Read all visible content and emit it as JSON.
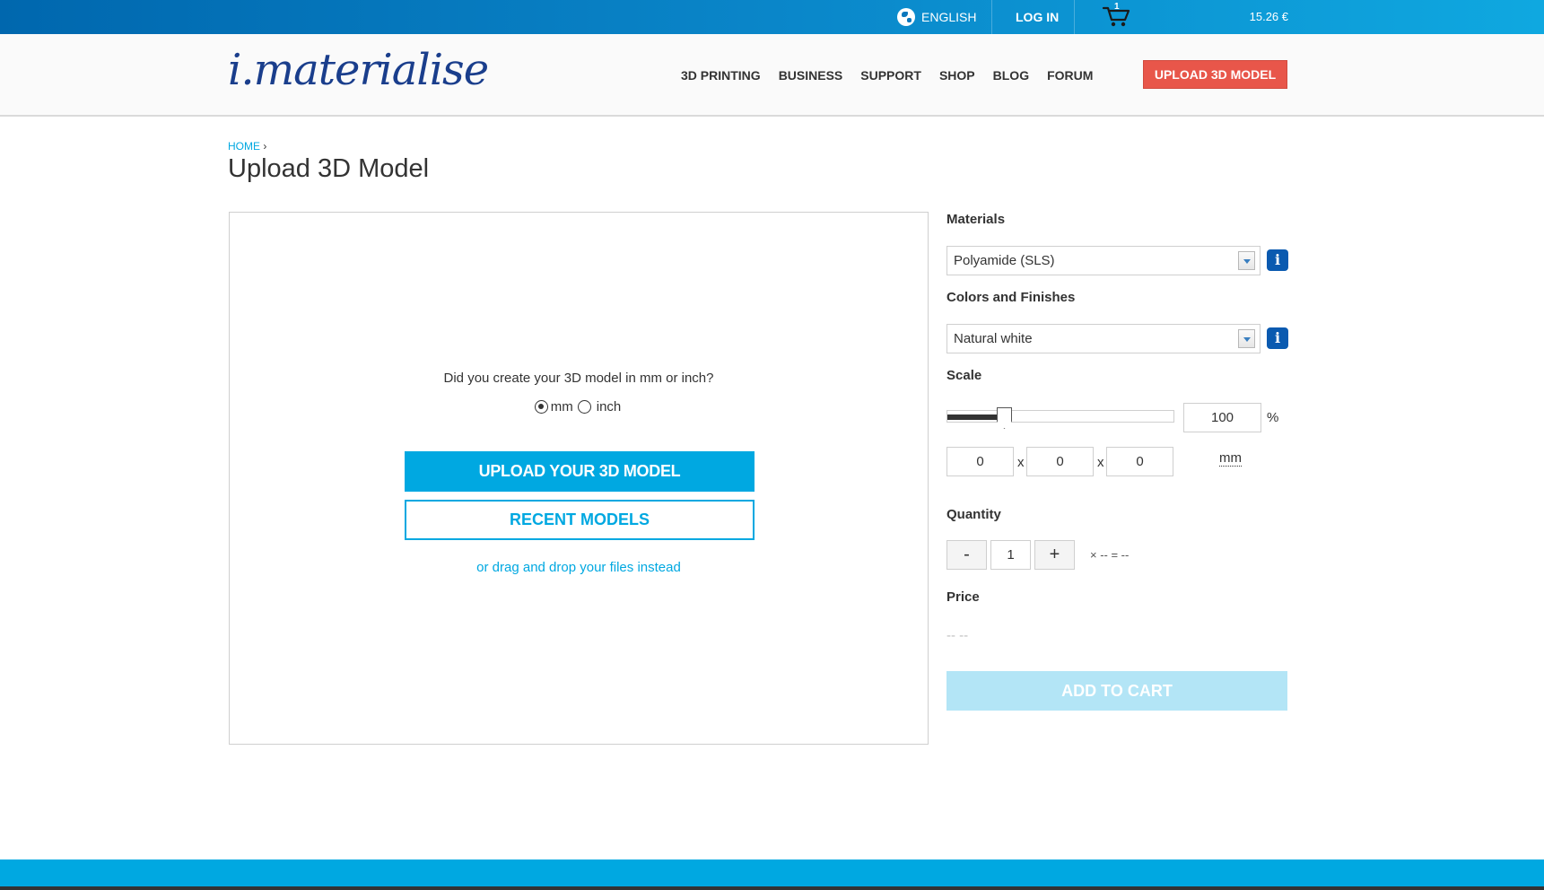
{
  "topbar": {
    "language": "ENGLISH",
    "login": "LOG IN",
    "cart_count": "1",
    "cart_total": "15.26 €"
  },
  "header": {
    "logo": "i.materialise",
    "nav": [
      "3D PRINTING",
      "BUSINESS",
      "SUPPORT",
      "SHOP",
      "BLOG",
      "FORUM"
    ],
    "upload_button": "UPLOAD 3D MODEL"
  },
  "breadcrumb": {
    "home": "HOME",
    "arrow": "›"
  },
  "page_title": "Upload 3D Model",
  "upload": {
    "question": "Did you create your 3D model in mm or inch?",
    "unit_mm": "mm",
    "unit_inch": "inch",
    "selected_unit": "mm",
    "upload_button": "UPLOAD YOUR 3D MODEL",
    "recent_button": "RECENT MODELS",
    "drag_text": "or drag and drop your files instead"
  },
  "config": {
    "materials_label": "Materials",
    "material_value": "Polyamide (SLS)",
    "colors_label": "Colors and Finishes",
    "color_value": "Natural white",
    "info_icon": "i",
    "scale_label": "Scale",
    "scale_value": "100",
    "scale_fraction": 0.25,
    "scale_unit": "%",
    "dim_x": "0",
    "dim_y": "0",
    "dim_z": "0",
    "dim_sep": "x",
    "dim_unit": "mm",
    "quantity_label": "Quantity",
    "qty_minus": "-",
    "qty_value": "1",
    "qty_plus": "+",
    "qty_formula": "× -- = --",
    "price_label": "Price",
    "price_value": "-- --",
    "add_to_cart": "ADD TO CART"
  },
  "colors": {
    "accent": "#00a8e1",
    "cta_red": "#e8564a",
    "info_blue": "#0a5ab0",
    "cart_disabled": "#b3e5f6"
  }
}
